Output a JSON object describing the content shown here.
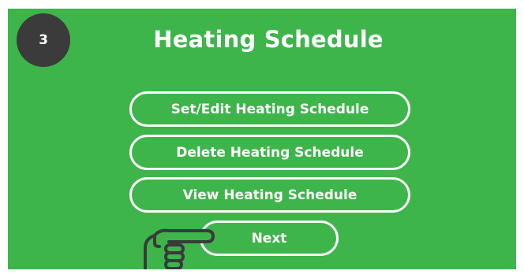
{
  "step": {
    "number": "3"
  },
  "header": {
    "title": "Heating Schedule"
  },
  "menu": {
    "items": [
      {
        "label": "Set/Edit Heating Schedule"
      },
      {
        "label": "Delete Heating Schedule"
      },
      {
        "label": "View Heating Schedule"
      }
    ]
  },
  "navigation": {
    "next_label": "Next"
  },
  "icons": {
    "pointer": "pointing-hand-icon"
  },
  "colors": {
    "background": "#3db54a",
    "badge": "#3b3b3b",
    "foreground": "#ffffff",
    "hand": "#3a3a3a"
  }
}
